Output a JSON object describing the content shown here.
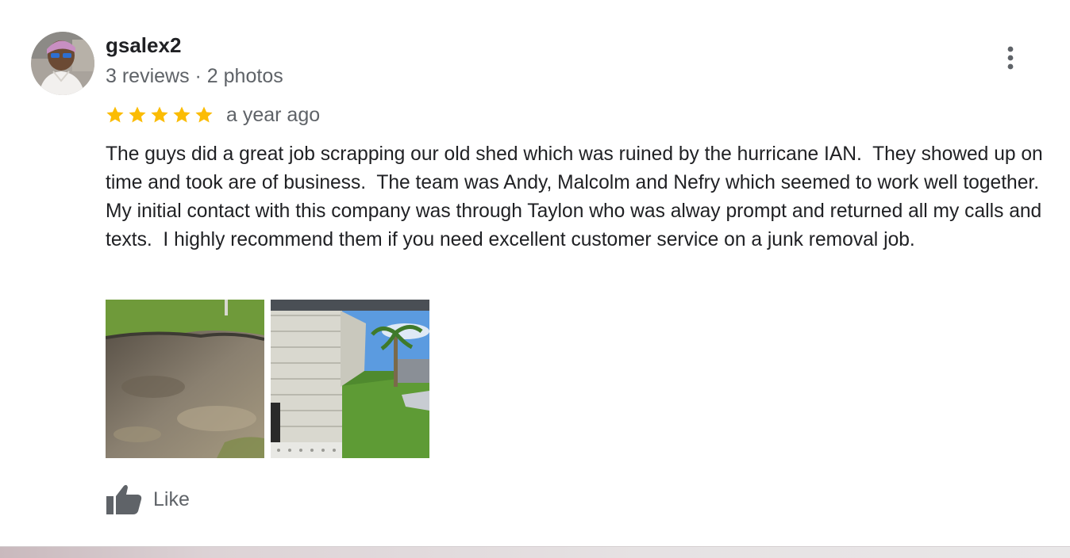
{
  "review": {
    "author": {
      "name": "gsalex2",
      "meta": "3 reviews · 2 photos",
      "avatar_icon": "profile-photo"
    },
    "rating": {
      "stars": 5,
      "max_stars": 5,
      "star_color": "#fbbc04",
      "date": "a year ago"
    },
    "text": "The guys did a great job scrapping our old shed which was ruined by the hurricane IAN.  They showed up on time and took are of business.  The team was Andy, Malcolm and Nefry which seemed to work well together.  My initial contact with this company was through Taylon who was alway prompt and returned all my calls and texts.  I highly recommend them if you need excellent customer service on a junk removal job.",
    "photos": [
      {
        "subject": "grass-and-dirt-patch"
      },
      {
        "subject": "damaged-shed-with-palm-tree"
      }
    ],
    "actions": {
      "like_label": "Like",
      "like_icon": "thumbs-up-icon",
      "more_icon": "more-vert-icon"
    }
  }
}
